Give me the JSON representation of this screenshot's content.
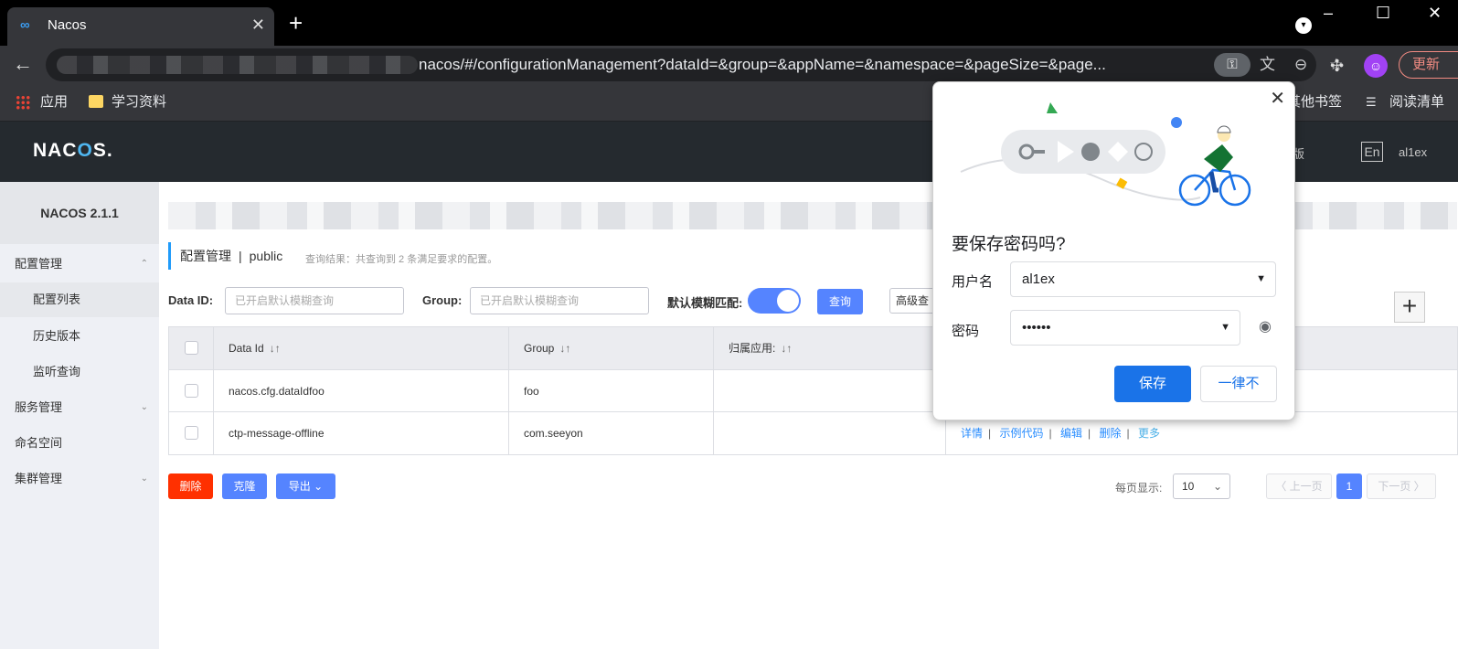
{
  "browser": {
    "tab_title": "Nacos",
    "tab_close": "✕",
    "new_tab": "+",
    "url": "nacos/#/configurationManagement?dataId=&group=&appName=&namespace=&pageSize=&page...",
    "update_label": "更新",
    "bookmarks": [
      "应用",
      "学习资料"
    ],
    "bookmarks_right": [
      "其他书签",
      "阅读清单"
    ],
    "icons": {
      "favicon": "nacos-infinity-icon",
      "back": "back-arrow-icon",
      "key": "key-icon",
      "translate": "translate-icon",
      "zoom": "zoom-out-icon",
      "star": "star-icon",
      "extensions": "puzzle-icon",
      "profile": "avatar-icon"
    }
  },
  "header": {
    "logo_prefix": "NAC",
    "logo_o": "O",
    "logo_suffix": "S.",
    "partial_link": "版",
    "lang": "En",
    "user": "al1ex"
  },
  "sidebar": {
    "version": "NACOS 2.1.1",
    "items": [
      {
        "label": "配置管理",
        "arrow": "⌃"
      },
      {
        "label": "配置列表"
      },
      {
        "label": "历史版本"
      },
      {
        "label": "监听查询"
      },
      {
        "label": "服务管理",
        "arrow": "⌄"
      },
      {
        "label": "命名空间"
      },
      {
        "label": "集群管理",
        "arrow": "⌄"
      }
    ]
  },
  "main": {
    "title": "配置管理",
    "separator": "|",
    "namespace": "public",
    "result_info": "查询结果：共查询到 2 条满足要求的配置。",
    "filters": {
      "dataid_label": "Data ID:",
      "dataid_placeholder": "已开启默认模糊查询",
      "group_label": "Group:",
      "group_placeholder": "已开启默认模糊查询",
      "fuzzy_label": "默认模糊匹配:",
      "query_btn": "查询",
      "advanced_btn": "高级查"
    },
    "table": {
      "headers": [
        "Data Id",
        "Group",
        "归属应用:"
      ],
      "sort_icon": "↓↑",
      "rows": [
        {
          "data_id": "nacos.cfg.dataIdfoo",
          "group": "foo",
          "app": ""
        },
        {
          "data_id": "ctp-message-offline",
          "group": "com.seeyon",
          "app": ""
        }
      ],
      "ops": [
        "详情",
        "示例代码",
        "编辑",
        "删除",
        "更多"
      ]
    },
    "actions": {
      "delete": "删除",
      "clone": "克隆",
      "export": "导出"
    },
    "pager": {
      "label": "每页显示:",
      "page_size": "10",
      "prev": "〈 上一页",
      "current": "1",
      "next": "下一页 〉"
    }
  },
  "password_popup": {
    "title": "要保存密码吗?",
    "username_label": "用户名",
    "username_value": "al1ex",
    "password_label": "密码",
    "password_value": "••••••",
    "save": "保存",
    "never": "一律不"
  }
}
